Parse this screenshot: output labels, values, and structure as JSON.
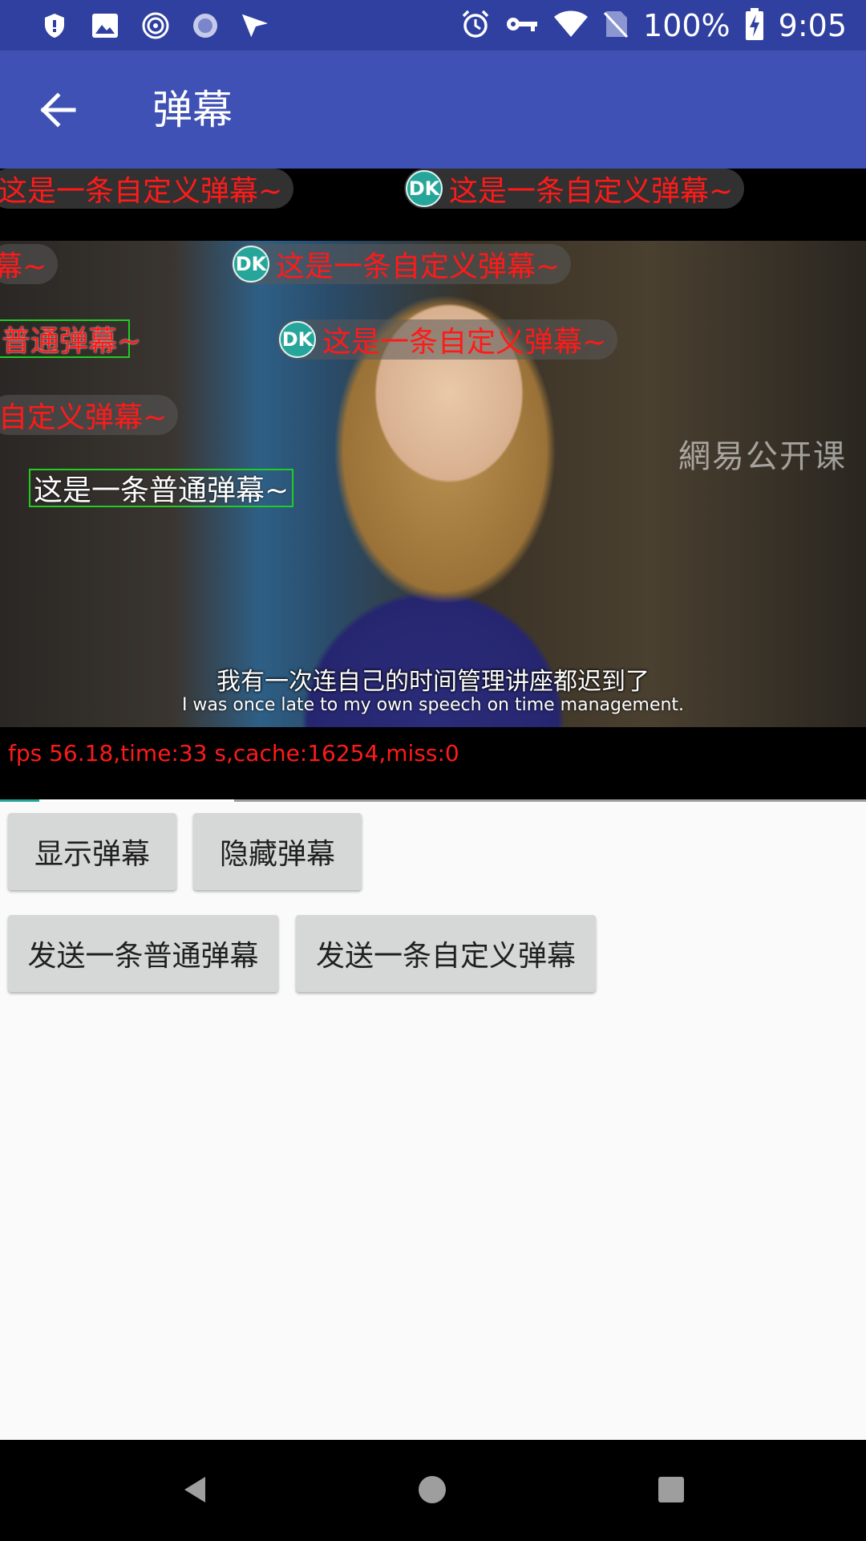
{
  "status_bar": {
    "battery": "100%",
    "time": "9:05",
    "left_icons": [
      "shield-icon",
      "image-icon",
      "spiral-icon",
      "sync-icon",
      "send-icon"
    ],
    "right_icons": [
      "alarm-icon",
      "key-icon",
      "wifi-icon",
      "no-sim-icon",
      "battery-charging-icon"
    ]
  },
  "app_bar": {
    "title": "弹幕",
    "back_icon": "arrow-back-icon"
  },
  "video": {
    "watermark": "網易公开课",
    "subtitle_zh": "我有一次连自己的时间管理讲座都迟到了",
    "subtitle_en": "I was once late to my own speech on time management.",
    "fps_text": "fps 56.18,time:33 s,cache:16254,miss:0",
    "progress": {
      "played": 0.045,
      "buffered": 0.27
    },
    "danmaku": [
      {
        "type": "custom",
        "text": "这是一条自定义弹幕~",
        "avatar": ""
      },
      {
        "type": "custom",
        "text": "这是一条自定义弹幕~",
        "avatar": "DK"
      },
      {
        "type": "custom",
        "text": "幕~",
        "avatar": ""
      },
      {
        "type": "custom",
        "text": "这是一条自定义弹幕~",
        "avatar": "DK"
      },
      {
        "type": "plain",
        "text": "普通弹幕~"
      },
      {
        "type": "custom",
        "text": "这是一条自定义弹幕~",
        "avatar": "DK"
      },
      {
        "type": "custom",
        "text": "自定义弹幕~",
        "avatar": ""
      },
      {
        "type": "plain",
        "text": "这是一条普通弹幕~"
      }
    ]
  },
  "buttons": {
    "show": "显示弹幕",
    "hide": "隐藏弹幕",
    "send_plain": "发送一条普通弹幕",
    "send_custom": "发送一条自定义弹幕"
  },
  "nav_bar": {
    "icons": [
      "back-triangle-icon",
      "home-circle-icon",
      "recents-square-icon"
    ]
  }
}
